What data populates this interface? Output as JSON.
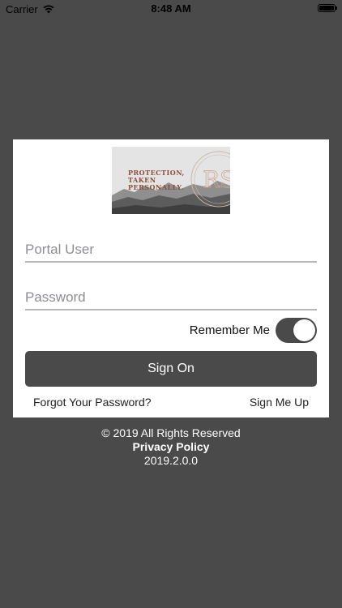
{
  "status_bar": {
    "carrier": "Carrier",
    "time": "8:48 AM",
    "wifi_icon": "wifi-icon",
    "battery_icon": "battery-icon"
  },
  "login": {
    "logo": {
      "line1": "PROTECTION,",
      "line2": "TAKEN",
      "line3": "PERSONALLY."
    },
    "username_placeholder": "Portal User",
    "password_placeholder": "Password",
    "remember_label": "Remember Me",
    "remember_on": true,
    "sign_on_label": "Sign On",
    "forgot_label": "Forgot Your Password?",
    "signup_label": "Sign Me Up"
  },
  "footer": {
    "copyright": "© 2019 All Rights Reserved",
    "privacy": "Privacy Policy",
    "version": "2019.2.0.0"
  },
  "colors": {
    "background": "#4a4a4b",
    "card": "#ffffff",
    "accent": "#4a4a4b"
  }
}
